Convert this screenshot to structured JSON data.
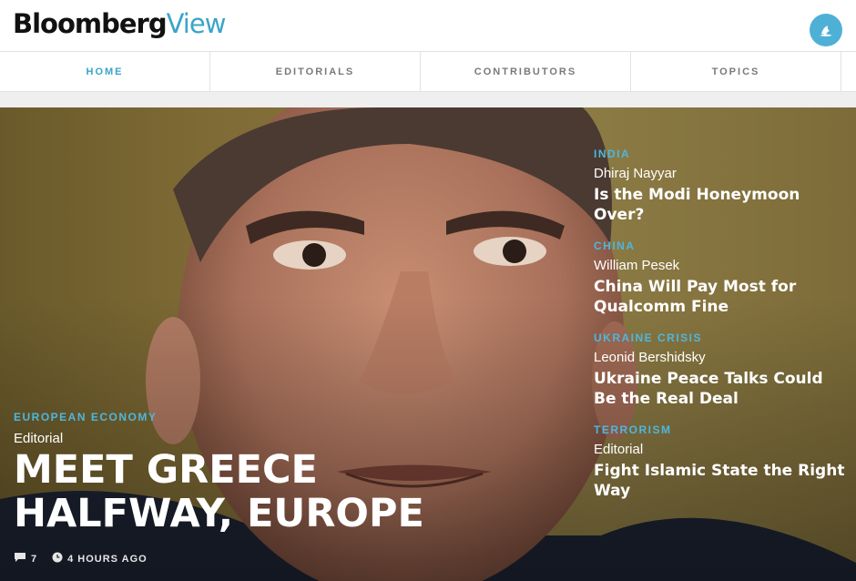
{
  "brand": {
    "part1": "Bloomberg",
    "part2": "View",
    "accent_color": "#3aa4c9"
  },
  "header": {
    "user_icon": "user-avatar-icon"
  },
  "nav": {
    "items": [
      {
        "label": "HOME",
        "active": true
      },
      {
        "label": "EDITORIALS",
        "active": false
      },
      {
        "label": "CONTRIBUTORS",
        "active": false
      },
      {
        "label": "TOPICS",
        "active": false
      }
    ]
  },
  "hero": {
    "kicker": "EUROPEAN ECONOMY",
    "byline": "Editorial",
    "title": "MEET GREECE HALFWAY, EUROPE",
    "comments": "7",
    "time": "4 HOURS AGO",
    "comment_icon": "comment-icon",
    "clock_icon": "clock-icon"
  },
  "side_stories": [
    {
      "kicker": "INDIA",
      "author": "Dhiraj Nayyar",
      "title": "Is the Modi Honeymoon Over?"
    },
    {
      "kicker": "CHINA",
      "author": "William Pesek",
      "title": "China Will Pay Most for Qualcomm Fine"
    },
    {
      "kicker": "UKRAINE CRISIS",
      "author": "Leonid Bershidsky",
      "title": "Ukraine Peace Talks Could Be the Real Deal"
    },
    {
      "kicker": "TERRORISM",
      "author": "Editorial",
      "title": "Fight Islamic State the Right Way"
    }
  ]
}
